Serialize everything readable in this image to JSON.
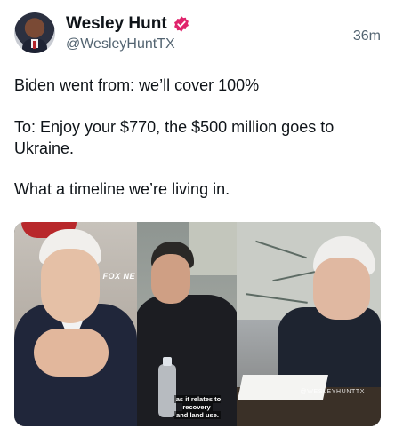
{
  "author": {
    "name": "Wesley Hunt",
    "handle": "@WesleyHuntTX",
    "verified_color": "#e0246c",
    "avatar_icon": "avatar-photo"
  },
  "post": {
    "time": "36m",
    "lines": [
      "Biden went from: we’ll cover 100%",
      "To: Enjoy your $770, the $500 million goes to Ukraine.",
      "What a timeline we’re living in."
    ]
  },
  "media": {
    "panel1_label": "FOX NE",
    "caption_line1": "as it relates to recovery",
    "caption_line2": "and land use.",
    "watermark": "@WESLEYHUNTTX"
  },
  "colors": {
    "text_primary": "#0f1419",
    "text_secondary": "#536471",
    "verified_badge": "#e0246c"
  }
}
